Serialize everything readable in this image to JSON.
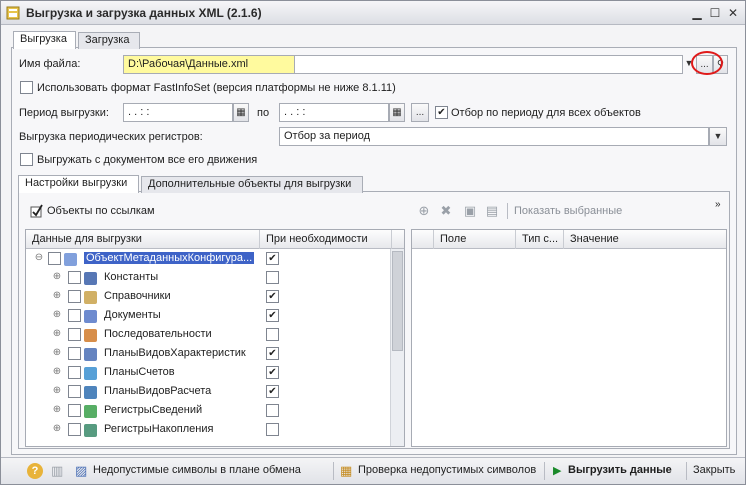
{
  "window": {
    "title": "Выгрузка и загрузка данных XML (2.1.6)",
    "min_icon": "minimize-icon",
    "max_icon": "maximize-icon",
    "close_icon": "close-icon"
  },
  "top_tabs": [
    {
      "label": "Выгрузка"
    },
    {
      "label": "Загрузка"
    }
  ],
  "file": {
    "label": "Имя файла:",
    "value": "D:\\Рабочая\\Данные.xml",
    "browse": "..."
  },
  "fastinfoset": {
    "label": "Использовать формат FastInfoSet (версия платформы не ниже 8.1.11)",
    "checked": false
  },
  "period": {
    "label": "Период выгрузки:",
    "from": " .   .       :  :  ",
    "to_label": "по",
    "to": " .   .       :  :  ",
    "browse": "...",
    "filter_label": "Отбор по периоду для всех объектов",
    "filter_checked": true
  },
  "periodic": {
    "label": "Выгрузка периодических регистров:",
    "value": "Отбор за период"
  },
  "with_movements": {
    "label": "Выгружать с документом все его движения",
    "checked": false
  },
  "inner_tabs": [
    {
      "label": "Настройки выгрузки"
    },
    {
      "label": "Дополнительные объекты для выгрузки"
    }
  ],
  "by_refs": {
    "label": "Объекты по ссылкам"
  },
  "right_toolbar": {
    "show_selected": "Показать выбранные"
  },
  "left_grid": {
    "headers": [
      "Данные для выгрузки",
      "При необходимости"
    ],
    "rows": [
      {
        "label": "ОбъектМетаданныхКонфигура...",
        "need": true
      },
      {
        "label": "Константы",
        "need": false
      },
      {
        "label": "Справочники",
        "need": true
      },
      {
        "label": "Документы",
        "need": true
      },
      {
        "label": "Последовательности",
        "need": false
      },
      {
        "label": "ПланыВидовХарактеристик",
        "need": true
      },
      {
        "label": "ПланыСчетов",
        "need": true
      },
      {
        "label": "ПланыВидовРасчета",
        "need": true
      },
      {
        "label": "РегистрыСведений",
        "need": false
      },
      {
        "label": "РегистрыНакопления",
        "need": false
      }
    ]
  },
  "right_grid": {
    "headers": [
      "Поле",
      "Тип с...",
      "Значение"
    ]
  },
  "bottom": {
    "invalid_symbols": "Недопустимые символы в плане обмена",
    "check_symbols": "Проверка недопустимых символов",
    "export": "Выгрузить данные",
    "close": "Закрыть"
  }
}
